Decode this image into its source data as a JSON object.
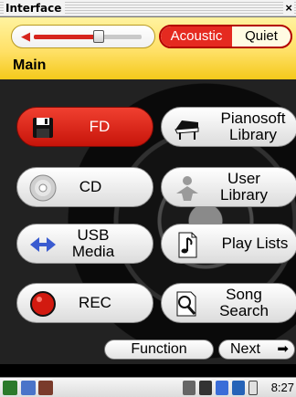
{
  "window": {
    "title": "Interface",
    "close_label": "×"
  },
  "header": {
    "volume_level": 0.6,
    "mode_options": [
      "Acoustic",
      "Quiet"
    ],
    "mode_selected": "Acoustic",
    "section_label": "Main"
  },
  "buttons": {
    "fd": "FD",
    "pianosoft_line1": "Pianosoft",
    "pianosoft_line2": "Library",
    "cd": "CD",
    "user_line1": "User",
    "user_line2": "Library",
    "usb_line1": "USB",
    "usb_line2": "Media",
    "playlists": "Play Lists",
    "rec": "REC",
    "song_line1": "Song",
    "song_line2": "Search"
  },
  "footer": {
    "function_label": "Function",
    "next_label": "Next"
  },
  "taskbar": {
    "time": "8:27"
  },
  "colors": {
    "accent_red": "#e52a20",
    "header_yellow": "#ffe066"
  }
}
